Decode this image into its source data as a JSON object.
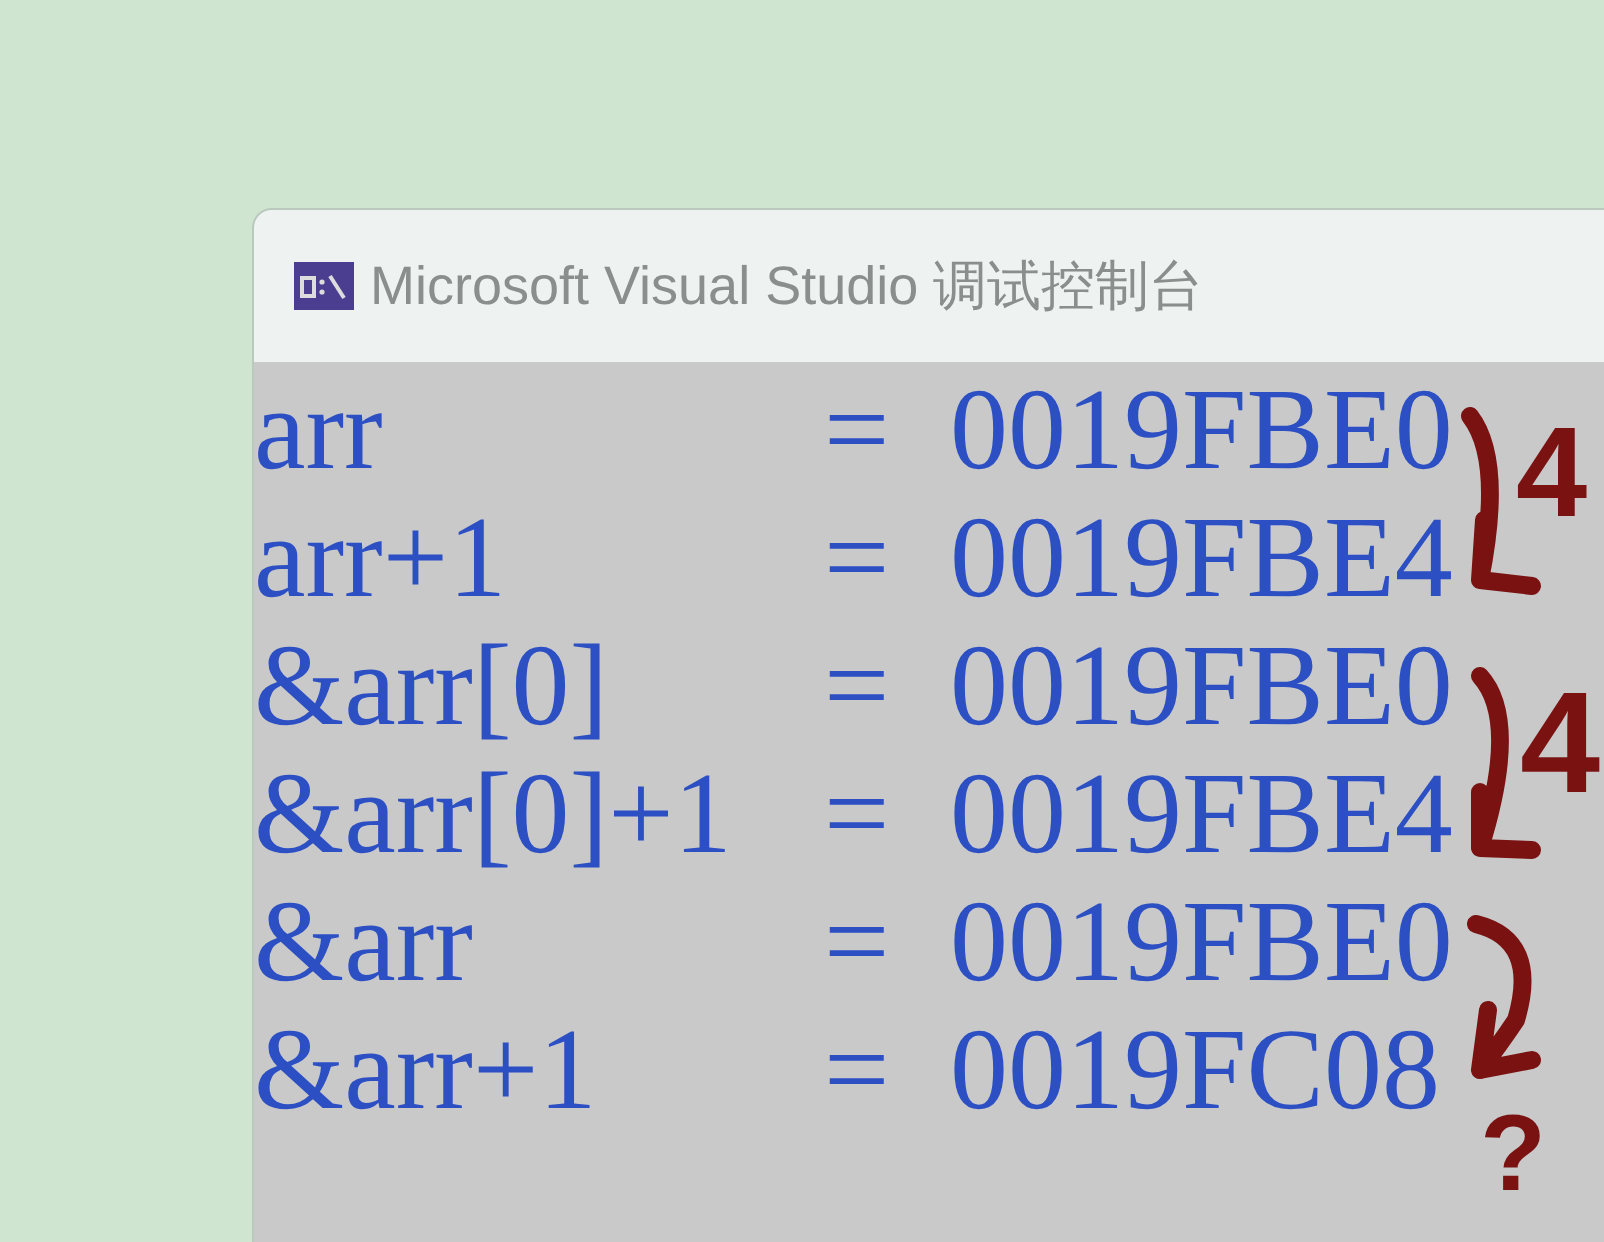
{
  "window": {
    "title": "Microsoft Visual Studio 调试控制台"
  },
  "console": {
    "lines": [
      {
        "label": "arr",
        "sep": "=",
        "value": "0019FBE0"
      },
      {
        "label": "arr+1",
        "sep": "=",
        "value": "0019FBE4"
      },
      {
        "label": "&arr[0]",
        "sep": "=",
        "value": "0019FBE0"
      },
      {
        "label": "&arr[0]+1",
        "sep": "=",
        "value": "0019FBE4"
      },
      {
        "label": "&arr",
        "sep": "=",
        "value": "0019FBE0"
      },
      {
        "label": "&arr+1",
        "sep": "=",
        "value": "0019FC08"
      }
    ]
  },
  "annotations": [
    "4",
    "4",
    "?"
  ]
}
